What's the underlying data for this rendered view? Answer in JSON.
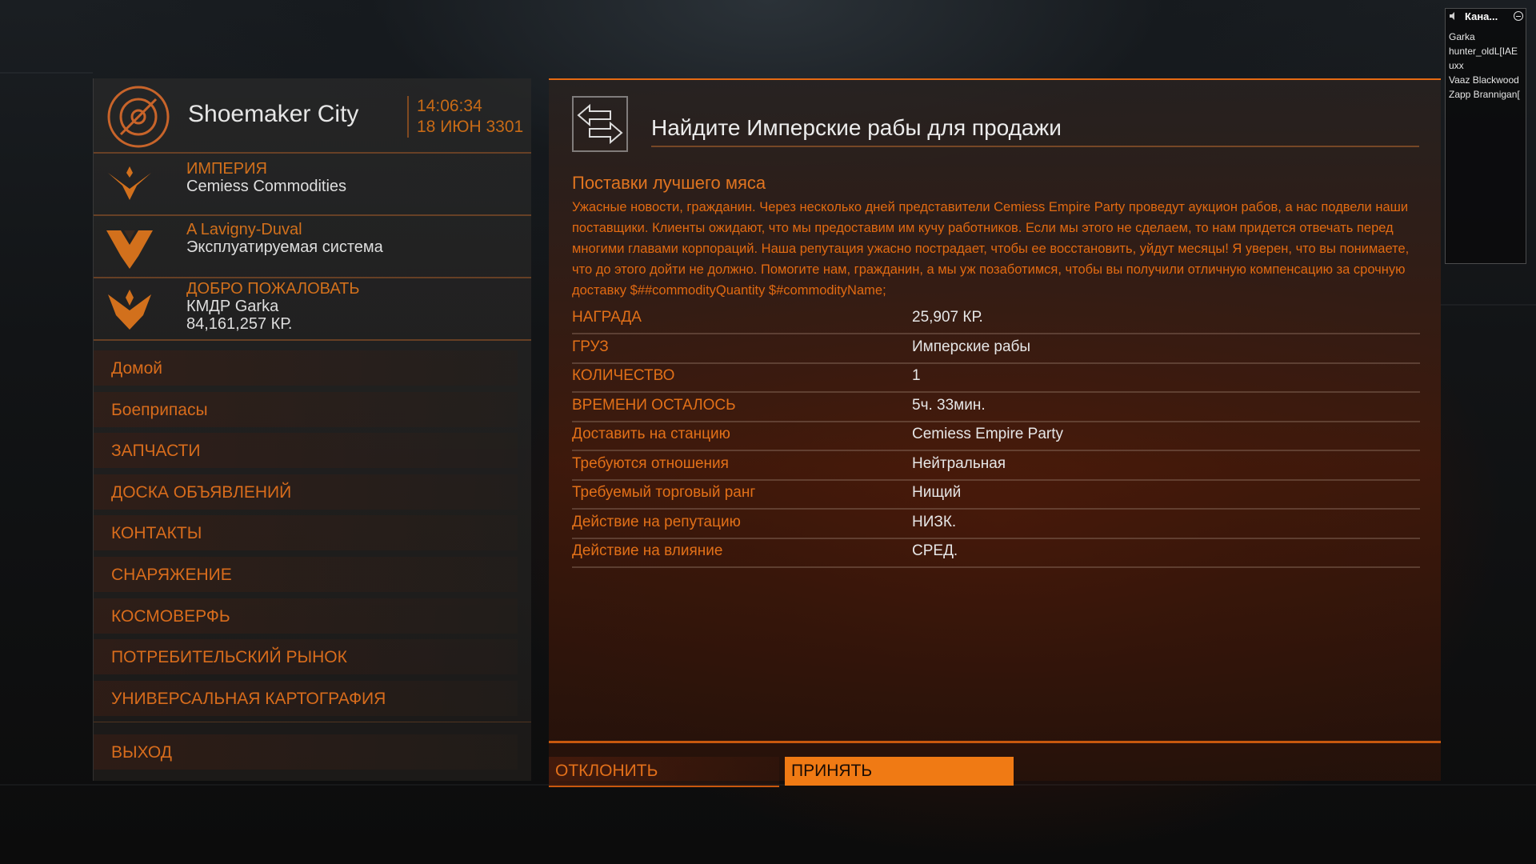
{
  "station": {
    "name": "Shoemaker City",
    "time": "14:06:34",
    "date": "18 ИЮН 3301",
    "faction_label": "ИМПЕРИЯ",
    "faction_name": "Cemiess Commodities",
    "system_label": "A Lavigny-Duval",
    "system_state": "Эксплуатируемая система",
    "welcome_label": "ДОБРО ПОЖАЛОВАТЬ",
    "commander": "КМДР Garka",
    "credits": "84,161,257 КР."
  },
  "menu": {
    "items": [
      "Домой",
      "Боеприпасы",
      "ЗАПЧАСТИ",
      "ДОСКА ОБЪЯВЛЕНИЙ",
      "КОНТАКТЫ",
      "СНАРЯЖЕНИЕ",
      "КОСМОВЕРФЬ",
      "ПОТРЕБИТЕЛЬСКИЙ РЫНОК",
      "УНИВЕРСАЛЬНАЯ КАРТОГРАФИЯ"
    ],
    "exit": "ВЫХОД"
  },
  "mission": {
    "title": "Найдите Имперские рабы для продажи",
    "subtitle": "Поставки лучшего мяса",
    "description": "Ужасные новости, гражданин. Через несколько дней представители Cemiess Empire Party проведут аукцион рабов, а нас подвели наши поставщики. Клиенты ожидают, что мы предоставим им кучу работников. Если мы этого не сделаем, то нам придется отвечать перед многими главами корпораций. Наша репутация ужасно пострадает, чтобы ее восстановить, уйдут месяцы! Я уверен, что вы понимаете, что до этого дойти не должно. Помогите нам, гражданин, а мы уж позаботимся, чтобы вы получили отличную компенсацию за срочную доставку $##commodityQuantity $#commodityName;",
    "details": [
      {
        "key": "НАГРАДА",
        "value": "25,907 КР."
      },
      {
        "key": "ГРУЗ",
        "value": "Имперские рабы"
      },
      {
        "key": "КОЛИЧЕСТВО",
        "value": "1"
      },
      {
        "key": "ВРЕМЕНИ ОСТАЛОСЬ",
        "value": "5ч. 33мин."
      },
      {
        "key": "Доставить на станцию",
        "value": "Cemiess Empire Party"
      },
      {
        "key": "Требуются отношения",
        "value": "Нейтральная"
      },
      {
        "key": "Требуемый торговый ранг",
        "value": "Нищий"
      },
      {
        "key": "Действие на репутацию",
        "value": "НИЗК."
      },
      {
        "key": "Действие на влияние",
        "value": "СРЕД."
      }
    ],
    "decline_label": "ОТКЛОНИТЬ",
    "accept_label": "ПРИНЯТЬ"
  },
  "chat": {
    "title": "Кана...",
    "users": [
      "Garka",
      "hunter_oldL[IAE",
      "uxx",
      "Vaaz Blackwood",
      "Zapp Brannigan["
    ]
  },
  "colors": {
    "accent": "#e66a12",
    "accept_button": "#f07a14",
    "text_light": "#e6e6e6"
  }
}
